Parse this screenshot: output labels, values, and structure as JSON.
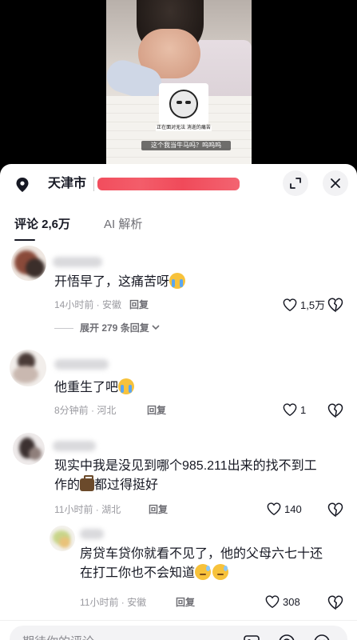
{
  "video": {
    "meme_caption": "正在面对无法\n消逝的痛苦",
    "subtitle": "这个我当牛马吗？呜呜呜"
  },
  "header": {
    "location": "天津市"
  },
  "tabs": [
    {
      "label": "评论 2,6万"
    },
    {
      "label": "AI 解析"
    }
  ],
  "comments": [
    {
      "text": "开悟早了，这痛苦呀",
      "emoji": "cry-face",
      "time": "14小时前 · 安徽",
      "reply_label": "回复",
      "likes": "1,5万",
      "expand": "展开 279 条回复"
    },
    {
      "text": "他重生了吧",
      "emoji": "cry-face",
      "time": "8分钟前 · 河北",
      "reply_label": "回复",
      "likes": "1"
    },
    {
      "text_line1": "现实中我是没见到哪个985.211出来的找不到工",
      "text_line2_pre": "作的",
      "emoji": "briefcase",
      "text_line2_post": "都过得挺好",
      "time": "11小时前 · 湖北",
      "reply_label": "回复",
      "likes": "140"
    },
    {
      "text_line1": "房贷车贷你就看不见了，他的父母六七十还",
      "text_line2": "在打工你也不会知道",
      "emoji": "sweat-face",
      "time": "11小时前 · 安徽",
      "reply_label": "回复",
      "likes": "308"
    }
  ],
  "input": {
    "placeholder": "期待你的评论"
  },
  "colors": {
    "redaction": "#f24d5d",
    "text": "#161823",
    "meta": "#9a9aa0"
  }
}
